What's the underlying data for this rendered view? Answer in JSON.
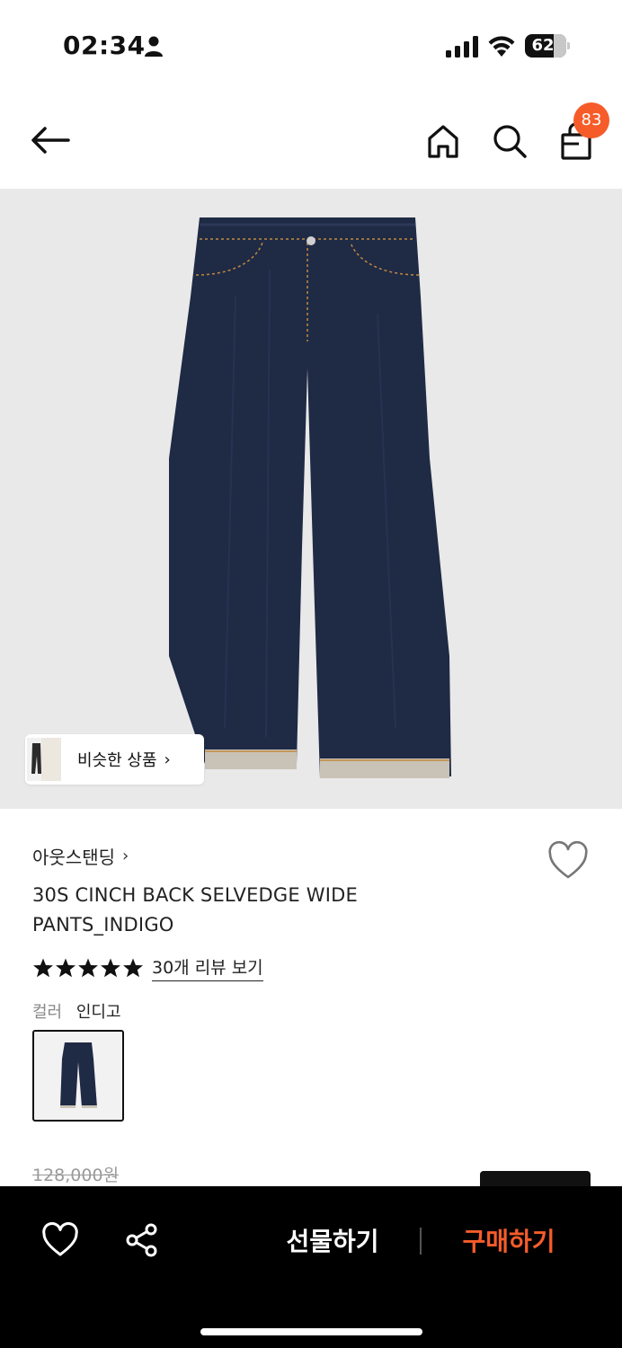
{
  "status_bar": {
    "time": "02:34",
    "battery": "62"
  },
  "header": {
    "cart_count": "83"
  },
  "hero": {
    "similar_label": "비슷한 상품",
    "similar_chevron": "›"
  },
  "product": {
    "brand": "아웃스탠딩",
    "brand_chevron": "›",
    "title": "30S CINCH BACK SELVEDGE WIDE PANTS_INDIGO",
    "rating_stars": 5,
    "review_link": "30개 리뷰 보기",
    "color_label": "컬러",
    "color_value": "인디고",
    "original_price": "128,000원"
  },
  "bottom_bar": {
    "gift_label": "선물하기",
    "buy_label": "구매하기"
  },
  "colors": {
    "accent": "#f65c2a",
    "denim": "#1f2a45",
    "hero_bg": "#e9e9e9"
  },
  "icons": [
    "person-icon",
    "signal-icon",
    "wifi-icon",
    "battery-icon",
    "back-arrow-icon",
    "home-icon",
    "search-icon",
    "cart-icon",
    "heart-icon",
    "star-icon",
    "share-icon",
    "chevron-right-icon"
  ]
}
